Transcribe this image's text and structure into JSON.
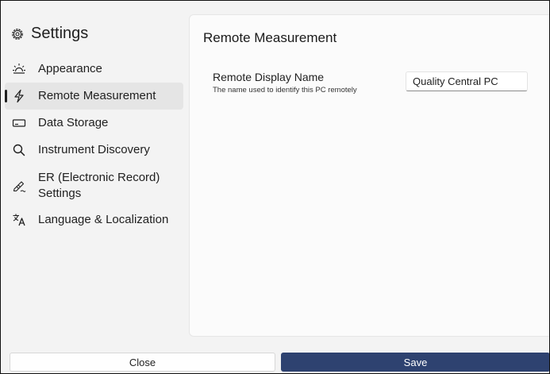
{
  "sidebar": {
    "title": "Settings",
    "items": [
      {
        "label": "Appearance",
        "icon": "appearance-icon"
      },
      {
        "label": "Remote Measurement",
        "icon": "bolt-icon",
        "active": true
      },
      {
        "label": "Data Storage",
        "icon": "storage-icon"
      },
      {
        "label": "Instrument Discovery",
        "icon": "search-icon"
      },
      {
        "label": "ER (Electronic Record) Settings",
        "icon": "signature-icon"
      },
      {
        "label": "Language & Localization",
        "icon": "language-icon"
      }
    ]
  },
  "main": {
    "title": "Remote Measurement",
    "field": {
      "label": "Remote Display Name",
      "description": "The name used to identify this PC remotely",
      "value": "Quality Central PC"
    }
  },
  "footer": {
    "close_label": "Close",
    "save_label": "Save"
  },
  "colors": {
    "accent": "#2e4270",
    "background": "#f3f3f3",
    "card": "#fbfbfb"
  }
}
